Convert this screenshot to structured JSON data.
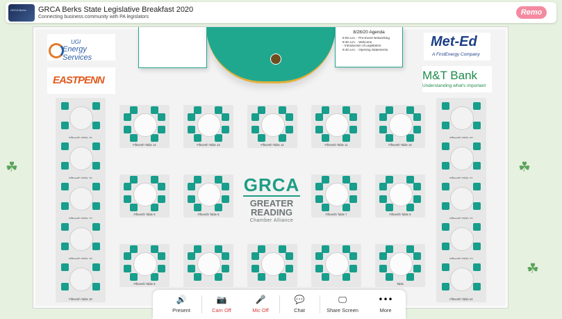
{
  "header": {
    "thumb_text": "GRCA Berks",
    "title": "GRCA Berks State Legislative Breakfast 2020",
    "subtitle": "Connecting business community with PA legislators",
    "brand": "Remo"
  },
  "agenda": {
    "title": "8/28/20 Agenda",
    "items": [
      "8:00 a.m. - Pre-Event Networking",
      "8:30 a.m. - Welcome",
      "- Introduction of Legislators",
      "8:40 a.m. - Opening Statements"
    ]
  },
  "logos": {
    "ugi": "UGI",
    "ugi_sub": "Energy Services",
    "eastpenn": "EASTPENN",
    "meted": "Met-Ed",
    "meted_sub": "A FirstEnergy Company",
    "mtb": "M&T Bank",
    "mtb_sub": "Understanding what's important"
  },
  "grca": {
    "acronym": "GRCA",
    "line1": "GREATER",
    "line2": "READING",
    "line3": "Chamber Alliance"
  },
  "tables": {
    "t15": "Fifteenth Table 15",
    "t16": "Fifteenth Table 16",
    "t17": "Fifteenth Table 17",
    "t18": "Fifteenth Table 18",
    "t19": "Fifteenth Table 19",
    "t14": "Fifteenth Table 14",
    "t13": "Fifteenth Table 13",
    "t12": "Fifteenth Table 12",
    "t11": "Fifteenth Table 11",
    "t10": "Fifteenth Table 10",
    "t20": "Fifteenth Table 20",
    "t21": "Fifteenth Table 21",
    "t22": "Fifteenth Table 22",
    "t23": "Fifteenth Table 23",
    "t24": "Fifteenth Table 24",
    "t9": "Fifteenth Table 9",
    "t8": "Fifteenth Table 8",
    "t7": "Fifteenth Table 7",
    "t6": "Fifteenth Table 6",
    "t5": "Fifteenth Table 5",
    "b2": "",
    "b3": "",
    "b4": "",
    "b5": "Table"
  },
  "toolbar": {
    "present": "Present",
    "cam": "Cam Off",
    "mic": "Mic Off",
    "chat": "Chat",
    "share": "Share Screen",
    "more": "More"
  },
  "colors": {
    "teal": "#179e8c",
    "accent_red": "#d63b3b",
    "remo_pink": "#f48aa0"
  }
}
